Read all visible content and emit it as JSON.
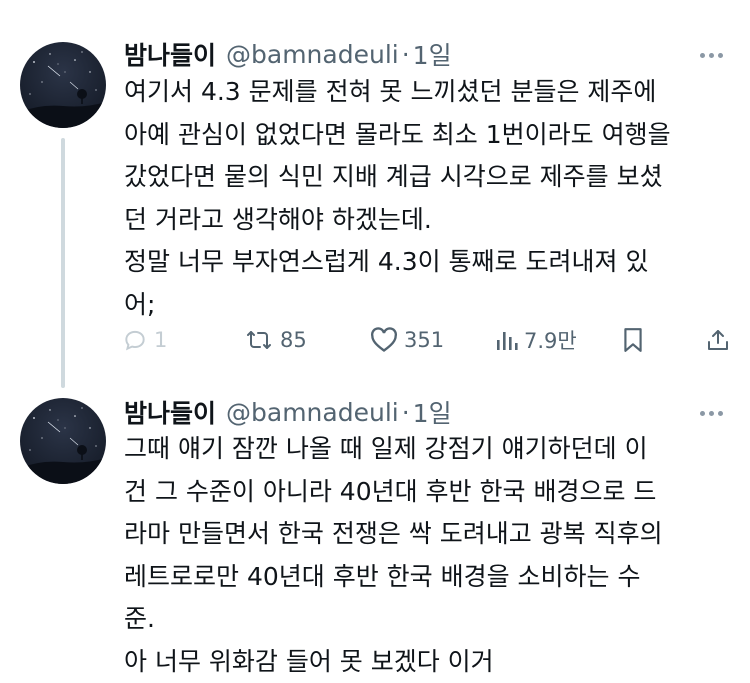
{
  "tweets": [
    {
      "display_name": "밤나들이",
      "handle": "@bamnadeuli",
      "separator": "·",
      "time": "1일",
      "lines": [
        "여기서 4.3 문제를 전혀 못 느끼셨던 분들은 제주에",
        "아예 관심이 없었다면 몰라도 최소 1번이라도 여행을",
        "갔었다면 뭍의 식민 지배 계급 시각으로 제주를 보셨",
        "던 거라고 생각해야 하겠는데.",
        "정말 너무 부자연스럽게 4.3이 통째로 도려내져 있",
        "어;"
      ],
      "actions": {
        "reply_count": "1",
        "retweet_count": "85",
        "like_count": "351",
        "view_count": "7.9만"
      }
    },
    {
      "display_name": "밤나들이",
      "handle": "@bamnadeuli",
      "separator": "·",
      "time": "1일",
      "lines": [
        "그때 얘기 잠깐 나올 때 일제 강점기 얘기하던데 이",
        "건 그 수준이 아니라 40년대 후반 한국 배경으로 드",
        "라마 만들면서 한국 전쟁은 싹 도려내고 광복 직후의",
        "레트로로만 40년대 후반 한국 배경을 소비하는 수",
        "준.",
        "아 너무 위화감 들어 못 보겠다 이거"
      ]
    }
  ],
  "icons": {
    "more": "more-horizontal-icon",
    "reply": "reply-icon",
    "retweet": "retweet-icon",
    "like": "heart-icon",
    "views": "views-chart-icon",
    "bookmark": "bookmark-icon",
    "share": "share-icon"
  },
  "colors": {
    "text": "#0f1419",
    "secondary": "#536471",
    "thread_line": "#cfd9de",
    "avatar_sky": "#1c2536"
  }
}
